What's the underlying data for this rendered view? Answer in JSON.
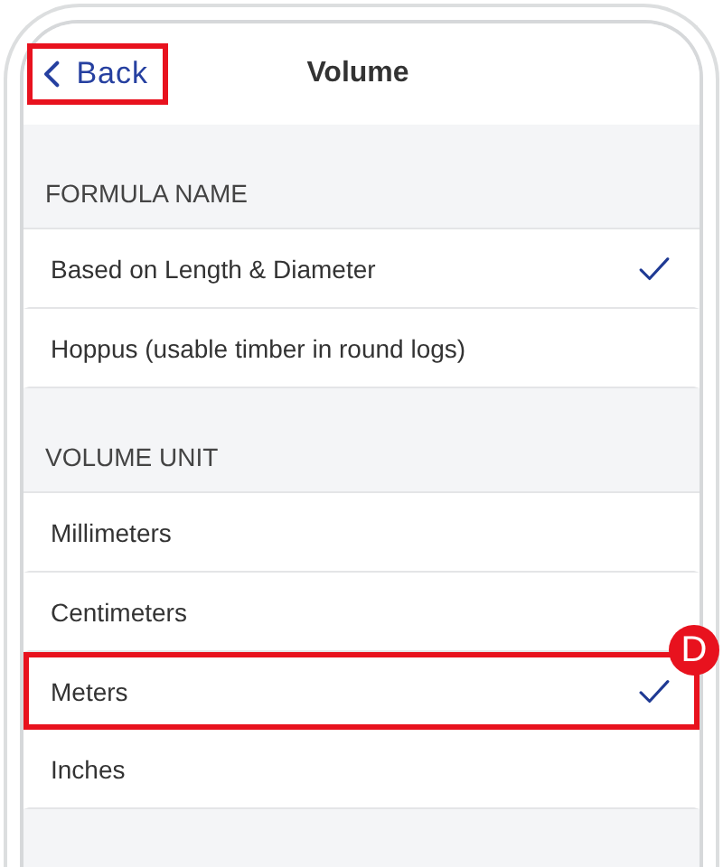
{
  "header": {
    "back": {
      "label": "Back",
      "highlighted": true
    },
    "title": "Volume"
  },
  "sections": [
    {
      "title": "FORMULA NAME",
      "items": [
        {
          "label": "Based on Length & Diameter",
          "selected": true,
          "highlighted": false
        },
        {
          "label": "Hoppus (usable timber in round logs)",
          "selected": false,
          "highlighted": false
        }
      ]
    },
    {
      "title": "VOLUME UNIT",
      "items": [
        {
          "label": "Millimeters",
          "selected": false,
          "highlighted": false
        },
        {
          "label": "Centimeters",
          "selected": false,
          "highlighted": false
        },
        {
          "label": "Meters",
          "selected": true,
          "highlighted": true,
          "badge": "D"
        },
        {
          "label": "Inches",
          "selected": false,
          "highlighted": false
        }
      ]
    }
  ]
}
